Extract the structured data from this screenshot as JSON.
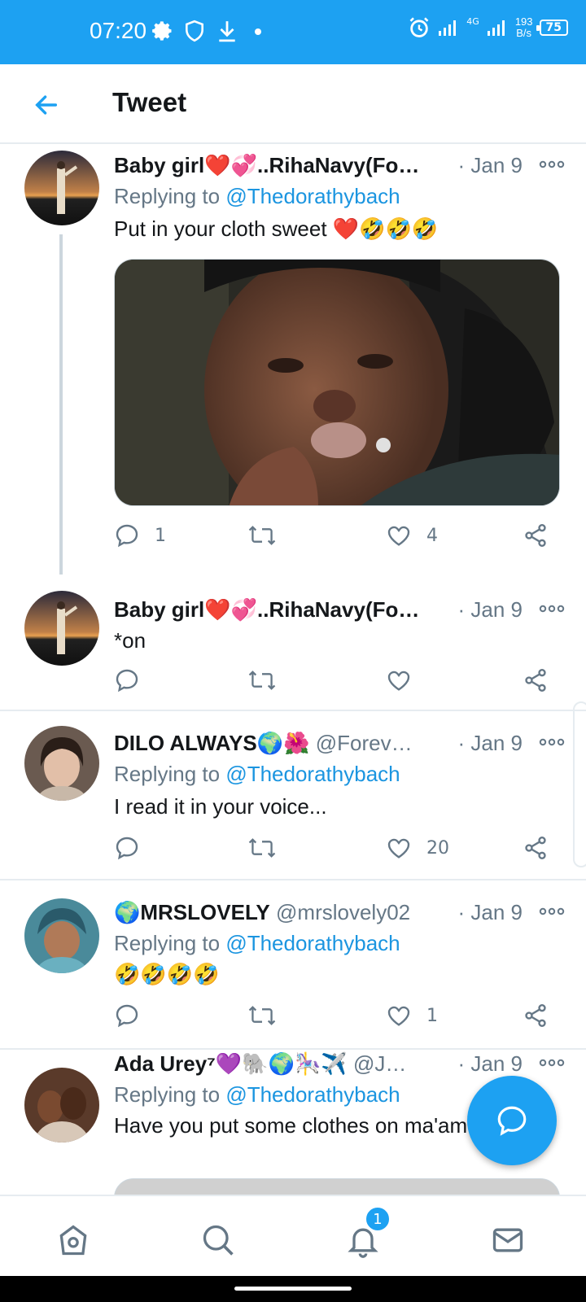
{
  "status_bar": {
    "time": "07:20",
    "network": "4G",
    "speed_value": "193",
    "speed_unit": "B/s",
    "battery": "75"
  },
  "header": {
    "title": "Tweet"
  },
  "tweets": [
    {
      "name": "Baby girl❤️💞..RihaNavy(Fo…",
      "handle": "",
      "date": "· Jan 9",
      "replying_label": "Replying to",
      "mention": "@Thedorathybach",
      "text": "Put in your cloth sweet ❤️🤣🤣🤣",
      "replies": "1",
      "likes": "4"
    },
    {
      "name": "Baby girl❤️💞..RihaNavy(Fo…",
      "handle": "",
      "date": "· Jan 9",
      "text": "*on",
      "replies": "",
      "likes": ""
    },
    {
      "name": "DILO ALWAYS🌍🌺",
      "handle": "@Forev…",
      "date": "· Jan 9",
      "replying_label": "Replying to",
      "mention": "@Thedorathybach",
      "text": "I read it in your voice...",
      "replies": "",
      "likes": "20"
    },
    {
      "name": "🌍MRSLOVELY",
      "handle": "@mrslovely02",
      "date": "· Jan 9",
      "replying_label": "Replying to",
      "mention": "@Thedorathybach",
      "text": "🤣🤣🤣🤣",
      "replies": "",
      "likes": "1"
    },
    {
      "name": "Ada Urey⁷💜🐘🌍🎠✈️",
      "handle": "@J…",
      "date": "· Jan 9",
      "replying_label": "Replying to",
      "mention": "@Thedorathybach",
      "text": "Have you put some clothes on ma'am",
      "replies": "",
      "likes": ""
    }
  ],
  "bottom_nav": {
    "notifications_badge": "1"
  },
  "colors": {
    "accent": "#1da1f2",
    "muted": "#657786",
    "mention": "#1b95e0"
  }
}
